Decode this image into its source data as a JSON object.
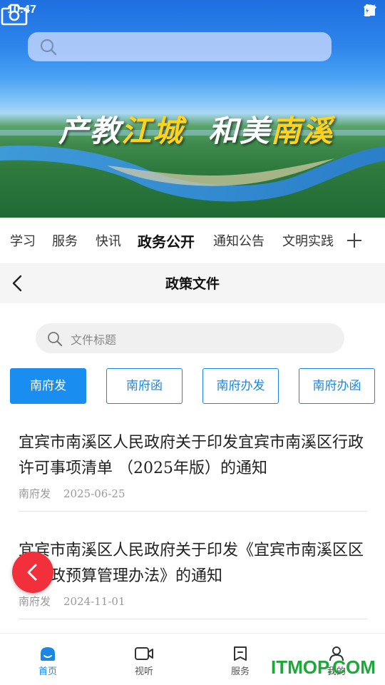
{
  "status_bar": {
    "time": "10:47"
  },
  "banner": {
    "slogan_left_white": "产教",
    "slogan_left_yellow": "江城",
    "slogan_right_white": "和美",
    "slogan_right_yellow": "南溪"
  },
  "channels": [
    {
      "label": "学习",
      "active": false
    },
    {
      "label": "服务",
      "active": false
    },
    {
      "label": "快讯",
      "active": false
    },
    {
      "label": "政务公开",
      "active": true
    },
    {
      "label": "通知公告",
      "active": false
    },
    {
      "label": "文明实践",
      "active": false
    }
  ],
  "header": {
    "title": "政策文件"
  },
  "doc_search": {
    "placeholder": "文件标题"
  },
  "filters": [
    {
      "label": "南府发",
      "active": true
    },
    {
      "label": "南府函",
      "active": false
    },
    {
      "label": "南府办发",
      "active": false
    },
    {
      "label": "南府办函",
      "active": false
    }
  ],
  "articles": [
    {
      "title": "宜宾市南溪区人民政府关于印发宜宾市南溪区行政许可事项清单 （2025年版）的通知",
      "type": "南府发",
      "date": "2025-06-25"
    },
    {
      "title": "宜宾市南溪区人民政府关于印发《宜宾市南溪区区级财政预算管理办法》的通知",
      "type": "南府发",
      "date": "2024-11-01"
    }
  ],
  "bottom_nav": [
    {
      "label": "首页",
      "icon": "home-icon",
      "active": true
    },
    {
      "label": "视听",
      "icon": "video-icon",
      "active": false
    },
    {
      "label": "服务",
      "icon": "bookmark-icon",
      "active": false
    },
    {
      "label": "我的",
      "icon": "user-icon",
      "active": false
    }
  ],
  "watermark": "ITMOP.COM",
  "colors": {
    "accent": "#1a86e6",
    "float_button": "#f2303b",
    "watermark": "#1fa83a"
  }
}
